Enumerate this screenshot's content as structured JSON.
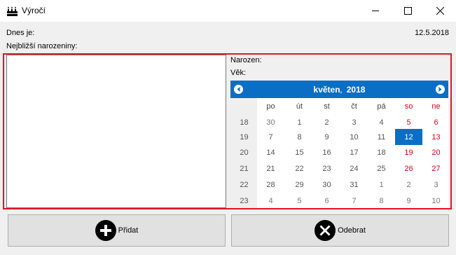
{
  "window": {
    "title": "Výročí",
    "app_icon": "birthday-cake-icon",
    "controls": [
      "minimize-icon",
      "maximize-icon",
      "close-icon"
    ]
  },
  "info": {
    "today_label": "Dnes je:",
    "today_value": "12.5.2018",
    "nearest_label": "Nejbližší narozeniny:"
  },
  "details": {
    "born_label": "Narozen:",
    "age_label": "Věk:"
  },
  "calendar": {
    "month": "květen",
    "year": "2018",
    "prev_icon": "arrow-left-icon",
    "next_icon": "arrow-right-icon",
    "day_headers": [
      "po",
      "út",
      "st",
      "čt",
      "pá",
      "so",
      "ne"
    ],
    "weekend_color": "#d9001b",
    "selected_color": "#0a6fc4",
    "selected_day": "12",
    "weeks": [
      {
        "num": "18",
        "days": [
          "30",
          "1",
          "2",
          "3",
          "4",
          "5",
          "6"
        ]
      },
      {
        "num": "19",
        "days": [
          "7",
          "8",
          "9",
          "10",
          "11",
          "12",
          "13"
        ]
      },
      {
        "num": "20",
        "days": [
          "14",
          "15",
          "16",
          "17",
          "18",
          "19",
          "20"
        ]
      },
      {
        "num": "21",
        "days": [
          "21",
          "22",
          "23",
          "24",
          "25",
          "26",
          "27"
        ]
      },
      {
        "num": "22",
        "days": [
          "28",
          "29",
          "30",
          "31",
          "1",
          "2",
          "3"
        ]
      },
      {
        "num": "23",
        "days": [
          "4",
          "5",
          "6",
          "7",
          "8",
          "9",
          "10"
        ]
      }
    ]
  },
  "buttons": {
    "add_label": "Přidat",
    "add_icon": "plus-circle-icon",
    "remove_label": "Odebrat",
    "remove_icon": "x-circle-icon"
  },
  "highlight_color": "#e81123"
}
